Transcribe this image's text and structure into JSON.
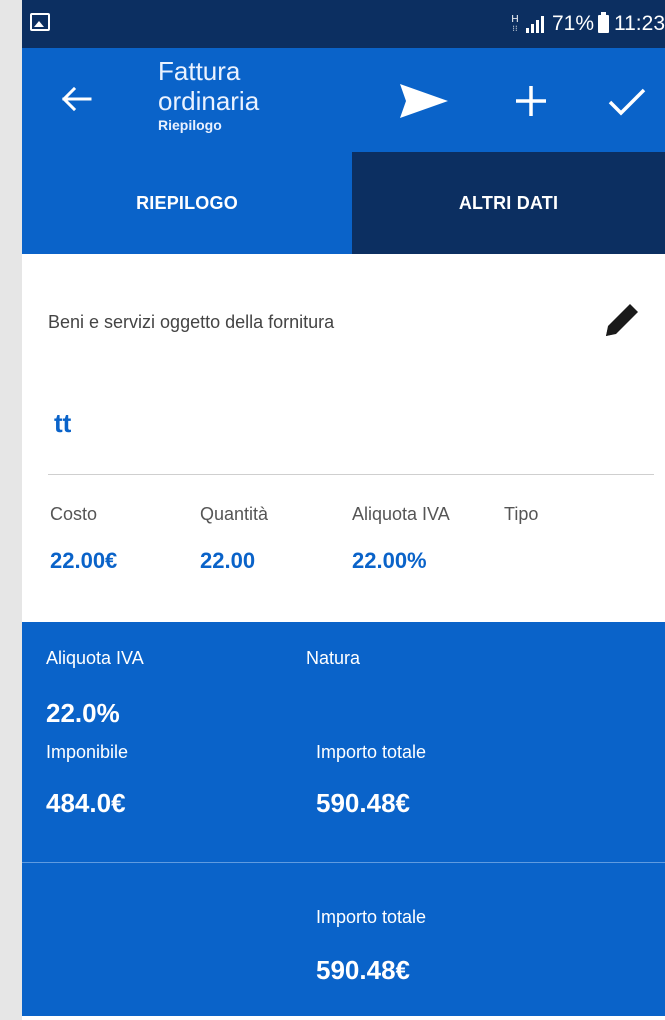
{
  "status_bar": {
    "network": "H",
    "battery_percent": "71%",
    "time": "11:23",
    "icons": [
      "gallery-icon",
      "signal-icon",
      "battery-icon"
    ]
  },
  "app_bar": {
    "title_line1": "Fattura",
    "title_line2": "ordinaria",
    "subtitle": "Riepilogo",
    "icons": [
      "back-arrow-icon",
      "send-icon",
      "add-icon",
      "check-icon"
    ]
  },
  "tabs": [
    {
      "label": "RIEPILOGO",
      "selected": true
    },
    {
      "label": "ALTRI DATI",
      "selected": false
    }
  ],
  "item_section": {
    "label": "Beni e servizi oggetto della fornitura",
    "edit_icon": "pencil-icon",
    "item_name": "tt",
    "columns": [
      {
        "label": "Costo",
        "value": "22.00€"
      },
      {
        "label": "Quantità",
        "value": "22.00"
      },
      {
        "label": "Aliquota IVA",
        "value": "22.00%"
      },
      {
        "label": "Tipo",
        "value": ""
      }
    ]
  },
  "summary": {
    "aliquota_label": "Aliquota IVA",
    "aliquota_value": "22.0%",
    "natura_label": "Natura",
    "imponibile_label": "Imponibile",
    "imponibile_value": "484.0€",
    "importo_label": "Importo totale",
    "importo_value": "590.48€"
  },
  "totals": {
    "importo_label": "Importo totale",
    "importo_value": "590.48€"
  },
  "colors": {
    "primary_blue": "#0a63c9",
    "dark_navy": "#0c2f61",
    "background": "#ffffff"
  }
}
